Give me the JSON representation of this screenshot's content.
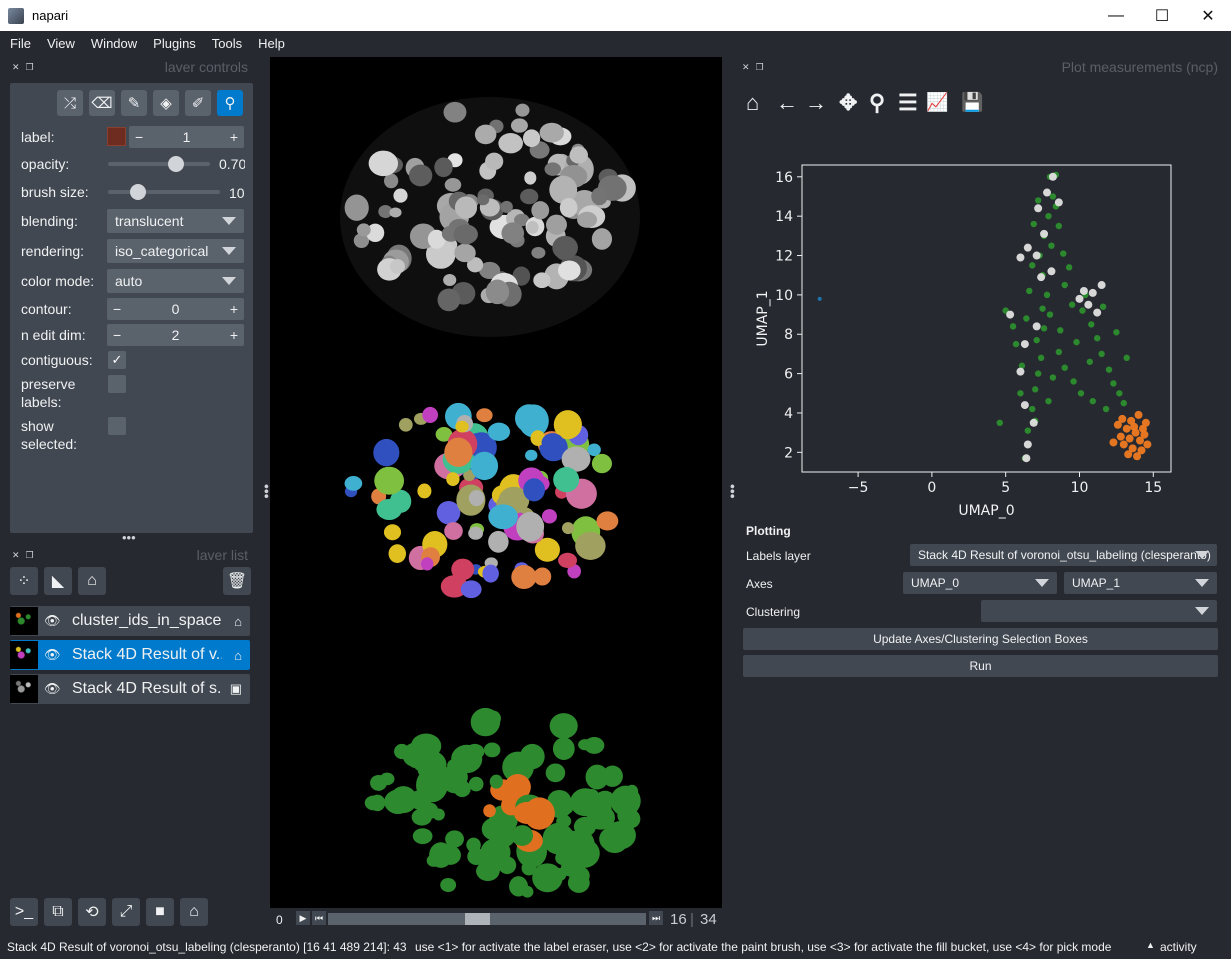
{
  "window": {
    "title": "napari",
    "buttons": [
      "—",
      "☐",
      "✕"
    ]
  },
  "menu": [
    "File",
    "View",
    "Window",
    "Plugins",
    "Tools",
    "Help"
  ],
  "layer_controls": {
    "title": "laver controls",
    "tools": [
      {
        "icon": "shuffle-icon",
        "glyph": "⤮"
      },
      {
        "icon": "eraser-icon",
        "glyph": "⌫"
      },
      {
        "icon": "paint-brush-icon",
        "glyph": "✎"
      },
      {
        "icon": "fill-bucket-icon",
        "glyph": "◈"
      },
      {
        "icon": "color-picker-icon",
        "glyph": "✐"
      },
      {
        "icon": "zoom-icon",
        "glyph": "⚲"
      }
    ],
    "label": {
      "name": "label:",
      "value": "1",
      "minus": "−",
      "plus": "+",
      "color": "#6e2b1f"
    },
    "opacity": {
      "name": "opacity:",
      "value": "0.70",
      "fraction": 0.7
    },
    "brush_size": {
      "name": "brush size:",
      "value": "10"
    },
    "blending": {
      "name": "blending:",
      "value": "translucent"
    },
    "rendering": {
      "name": "rendering:",
      "value": "iso_categorical"
    },
    "color_mode": {
      "name": "color mode:",
      "value": "auto"
    },
    "contour": {
      "name": "contour:",
      "value": "0",
      "minus": "−",
      "plus": "+"
    },
    "n_edit_dim": {
      "name": "n edit dim:",
      "value": "2",
      "minus": "−",
      "plus": "+"
    },
    "contiguous": {
      "name": "contiguous:",
      "checked": true,
      "mark": "✓"
    },
    "preserve_labels": {
      "name_line1": "preserve",
      "name_line2": "labels:",
      "checked": false
    },
    "show_selected": {
      "name_line1": "show",
      "name_line2": "selected:",
      "checked": false
    }
  },
  "layer_list": {
    "title": "laver list",
    "layers": [
      {
        "name": "cluster_ids_in_space",
        "type_icon": "label-tag-icon",
        "type_glyph": "⌂",
        "selected": false
      },
      {
        "name": "Stack 4D Result of v...",
        "type_icon": "label-tag-icon",
        "type_glyph": "⌂",
        "selected": true
      },
      {
        "name": "Stack 4D Result of s...",
        "type_icon": "image-icon",
        "type_glyph": "▣",
        "selected": false
      }
    ],
    "eye_glyph": "👁"
  },
  "dims": {
    "start": "0",
    "current": "16",
    "total": "34"
  },
  "plot": {
    "title": "Plot measurements (ncp)",
    "tool_glyphs": [
      "⌂",
      "←",
      "→",
      "✥",
      "⚲",
      "☰",
      "📈",
      "💾"
    ],
    "section_title": "Plotting",
    "labels_layer_label": "Labels layer",
    "labels_layer_value": "Stack 4D Result of voronoi_otsu_labeling (clesperanto)",
    "axes_label": "Axes",
    "axis_x_value": "UMAP_0",
    "axis_y_value": "UMAP_1",
    "clustering_label": "Clustering",
    "clustering_value": "",
    "update_button": "Update Axes/Clustering Selection Boxes",
    "run_button": "Run"
  },
  "chart_data": {
    "type": "scatter",
    "xlabel": "UMAP_0",
    "ylabel": "UMAP_1",
    "xlim": [
      -8.8,
      16.2
    ],
    "ylim": [
      1.0,
      16.6
    ],
    "xticks": [
      -5,
      0,
      5,
      10,
      15
    ],
    "yticks": [
      2,
      4,
      6,
      8,
      10,
      12,
      14,
      16
    ],
    "series": [
      {
        "color": "#2e9a2e",
        "points": [
          [
            6.3,
            1.7
          ],
          [
            6.5,
            3.1
          ],
          [
            6.8,
            4.2
          ],
          [
            7.0,
            5.2
          ],
          [
            7.2,
            6.0
          ],
          [
            7.4,
            6.8
          ],
          [
            7.1,
            7.7
          ],
          [
            7.6,
            8.3
          ],
          [
            8.0,
            9.0
          ],
          [
            7.8,
            10.0
          ],
          [
            7.5,
            11.0
          ],
          [
            7.3,
            12.0
          ],
          [
            7.6,
            13.0
          ],
          [
            7.9,
            14.0
          ],
          [
            8.2,
            15.0
          ],
          [
            8.0,
            16.0
          ],
          [
            8.4,
            14.5
          ],
          [
            8.6,
            13.5
          ],
          [
            8.1,
            12.5
          ],
          [
            6.8,
            11.5
          ],
          [
            9.0,
            10.5
          ],
          [
            9.5,
            9.5
          ],
          [
            10.2,
            9.2
          ],
          [
            10.8,
            8.5
          ],
          [
            11.2,
            7.8
          ],
          [
            11.5,
            7.0
          ],
          [
            12.0,
            6.2
          ],
          [
            12.3,
            5.5
          ],
          [
            12.7,
            5.0
          ],
          [
            13.0,
            4.5
          ],
          [
            11.8,
            4.2
          ],
          [
            10.9,
            4.6
          ],
          [
            10.1,
            5.0
          ],
          [
            9.6,
            5.6
          ],
          [
            9.0,
            6.3
          ],
          [
            8.6,
            7.1
          ],
          [
            8.2,
            5.8
          ],
          [
            7.9,
            4.6
          ],
          [
            7.0,
            3.6
          ],
          [
            5.5,
            8.4
          ],
          [
            5.0,
            9.2
          ],
          [
            5.7,
            7.5
          ],
          [
            6.1,
            6.4
          ],
          [
            6.4,
            8.8
          ],
          [
            6.6,
            10.2
          ],
          [
            9.3,
            11.4
          ],
          [
            8.9,
            12.1
          ],
          [
            8.4,
            16.1
          ],
          [
            7.2,
            14.8
          ],
          [
            6.9,
            13.6
          ],
          [
            10.4,
            10.0
          ],
          [
            11.6,
            9.4
          ],
          [
            12.5,
            8.1
          ],
          [
            13.2,
            6.8
          ],
          [
            9.8,
            7.6
          ],
          [
            8.7,
            8.2
          ],
          [
            7.5,
            9.3
          ],
          [
            6.0,
            5.0
          ],
          [
            4.6,
            3.5
          ],
          [
            10.7,
            6.6
          ]
        ]
      },
      {
        "color": "#e0e0e0",
        "points": [
          [
            6.4,
            1.7
          ],
          [
            6.5,
            2.4
          ],
          [
            6.9,
            3.5
          ],
          [
            6.3,
            4.4
          ],
          [
            6.0,
            6.1
          ],
          [
            6.3,
            7.5
          ],
          [
            7.1,
            8.4
          ],
          [
            5.3,
            9.0
          ],
          [
            6.0,
            11.9
          ],
          [
            7.1,
            12.0
          ],
          [
            6.5,
            12.4
          ],
          [
            7.2,
            14.4
          ],
          [
            7.8,
            15.2
          ],
          [
            8.2,
            16.0
          ],
          [
            8.6,
            14.7
          ],
          [
            7.6,
            13.1
          ],
          [
            10.0,
            9.8
          ],
          [
            10.6,
            9.5
          ],
          [
            11.2,
            9.1
          ],
          [
            10.9,
            10.1
          ],
          [
            11.5,
            10.5
          ],
          [
            10.3,
            10.2
          ],
          [
            7.4,
            10.9
          ],
          [
            8.1,
            11.2
          ]
        ]
      },
      {
        "color": "#ee7a22",
        "points": [
          [
            12.3,
            2.5
          ],
          [
            12.8,
            2.8
          ],
          [
            13.2,
            3.2
          ],
          [
            13.5,
            3.6
          ],
          [
            13.8,
            3.0
          ],
          [
            14.1,
            2.6
          ],
          [
            14.3,
            3.2
          ],
          [
            14.5,
            3.5
          ],
          [
            13.6,
            2.2
          ],
          [
            13.9,
            1.8
          ],
          [
            14.2,
            2.1
          ],
          [
            12.6,
            3.4
          ],
          [
            13.0,
            2.4
          ],
          [
            13.4,
            2.7
          ],
          [
            14.0,
            3.9
          ],
          [
            14.4,
            2.9
          ],
          [
            12.9,
            3.7
          ],
          [
            13.7,
            3.3
          ],
          [
            14.6,
            2.4
          ],
          [
            13.3,
            1.9
          ]
        ]
      },
      {
        "color": "#1f77b4",
        "points": [
          [
            -7.6,
            9.8
          ]
        ]
      }
    ]
  },
  "bottom_tools": [
    {
      "icon": "console-icon",
      "glyph": ">_"
    },
    {
      "icon": "ndisplay-3d-icon",
      "glyph": "⧉"
    },
    {
      "icon": "roll-dims-icon",
      "glyph": "⟲"
    },
    {
      "icon": "transpose-icon",
      "glyph": "⤢"
    },
    {
      "icon": "grid-toggle-icon",
      "glyph": "■"
    },
    {
      "icon": "home-icon",
      "glyph": "⌂"
    }
  ],
  "status": {
    "left": "Stack 4D Result of voronoi_otsu_labeling (clesperanto) [16 41 489 214]: 43",
    "help": "use <1> for activate the label eraser, use <2> for activate the paint brush, use <3> for activate the fill bucket, use <4> for pick mode",
    "activity": "activity",
    "activity_glyph": "▲"
  }
}
